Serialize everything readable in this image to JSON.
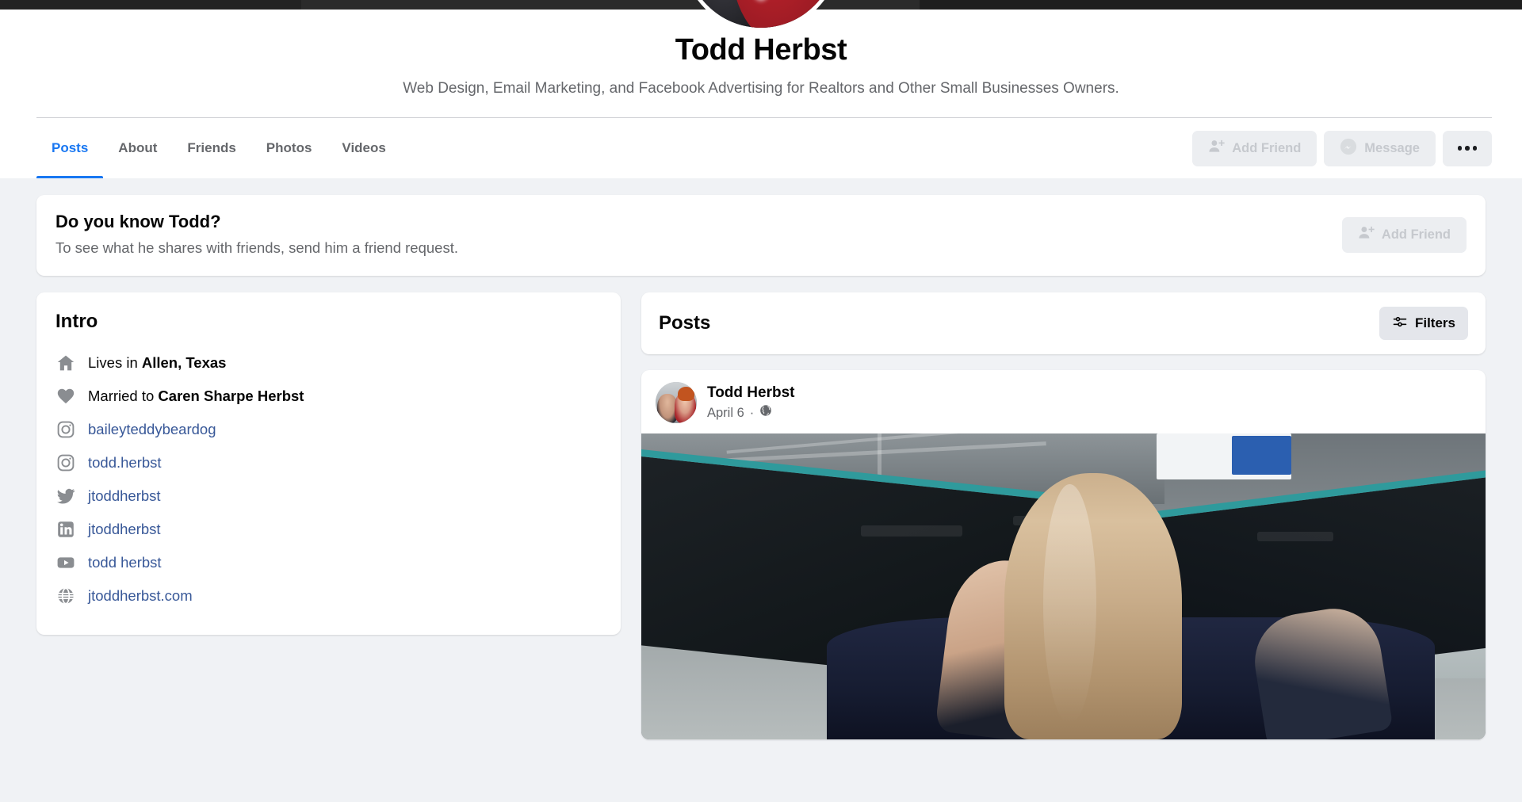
{
  "profile": {
    "name": "Todd Herbst",
    "bio": "Web Design, Email Marketing, and Facebook Advertising for Realtors and Other Small Businesses Owners."
  },
  "tabs": [
    {
      "label": "Posts",
      "active": true
    },
    {
      "label": "About",
      "active": false
    },
    {
      "label": "Friends",
      "active": false
    },
    {
      "label": "Photos",
      "active": false
    },
    {
      "label": "Videos",
      "active": false
    }
  ],
  "header_actions": {
    "add_friend_label": "Add Friend",
    "message_label": "Message",
    "more_label": "..."
  },
  "know_card": {
    "title": "Do you know Todd?",
    "subtitle": "To see what he shares with friends, send him a friend request.",
    "add_friend_label": "Add Friend"
  },
  "intro": {
    "title": "Intro",
    "items": [
      {
        "icon": "home-icon",
        "prefix": "Lives in ",
        "value": "Allen, Texas",
        "link": false
      },
      {
        "icon": "heart-icon",
        "prefix": "Married to ",
        "value": "Caren Sharpe Herbst",
        "link": false
      },
      {
        "icon": "instagram-icon",
        "prefix": "",
        "value": "baileyteddybeardog",
        "link": true
      },
      {
        "icon": "instagram-icon",
        "prefix": "",
        "value": "todd.herbst",
        "link": true
      },
      {
        "icon": "twitter-icon",
        "prefix": "",
        "value": "jtoddherbst",
        "link": true
      },
      {
        "icon": "linkedin-icon",
        "prefix": "",
        "value": "jtoddherbst",
        "link": true
      },
      {
        "icon": "youtube-icon",
        "prefix": "",
        "value": "todd herbst",
        "link": true
      },
      {
        "icon": "website-icon",
        "prefix": "",
        "value": "jtoddherbst.com",
        "link": true
      }
    ]
  },
  "posts_section": {
    "title": "Posts",
    "filters_label": "Filters"
  },
  "post": {
    "author": "Todd Herbst",
    "date": "April 6",
    "separator": "·",
    "privacy": "public-globe-icon"
  },
  "colors": {
    "accent": "#1877f2",
    "link": "#385898",
    "page_bg": "#f0f2f5",
    "card_bg": "#ffffff",
    "muted_text": "#65676b",
    "disabled_text": "#c6c9ce"
  }
}
